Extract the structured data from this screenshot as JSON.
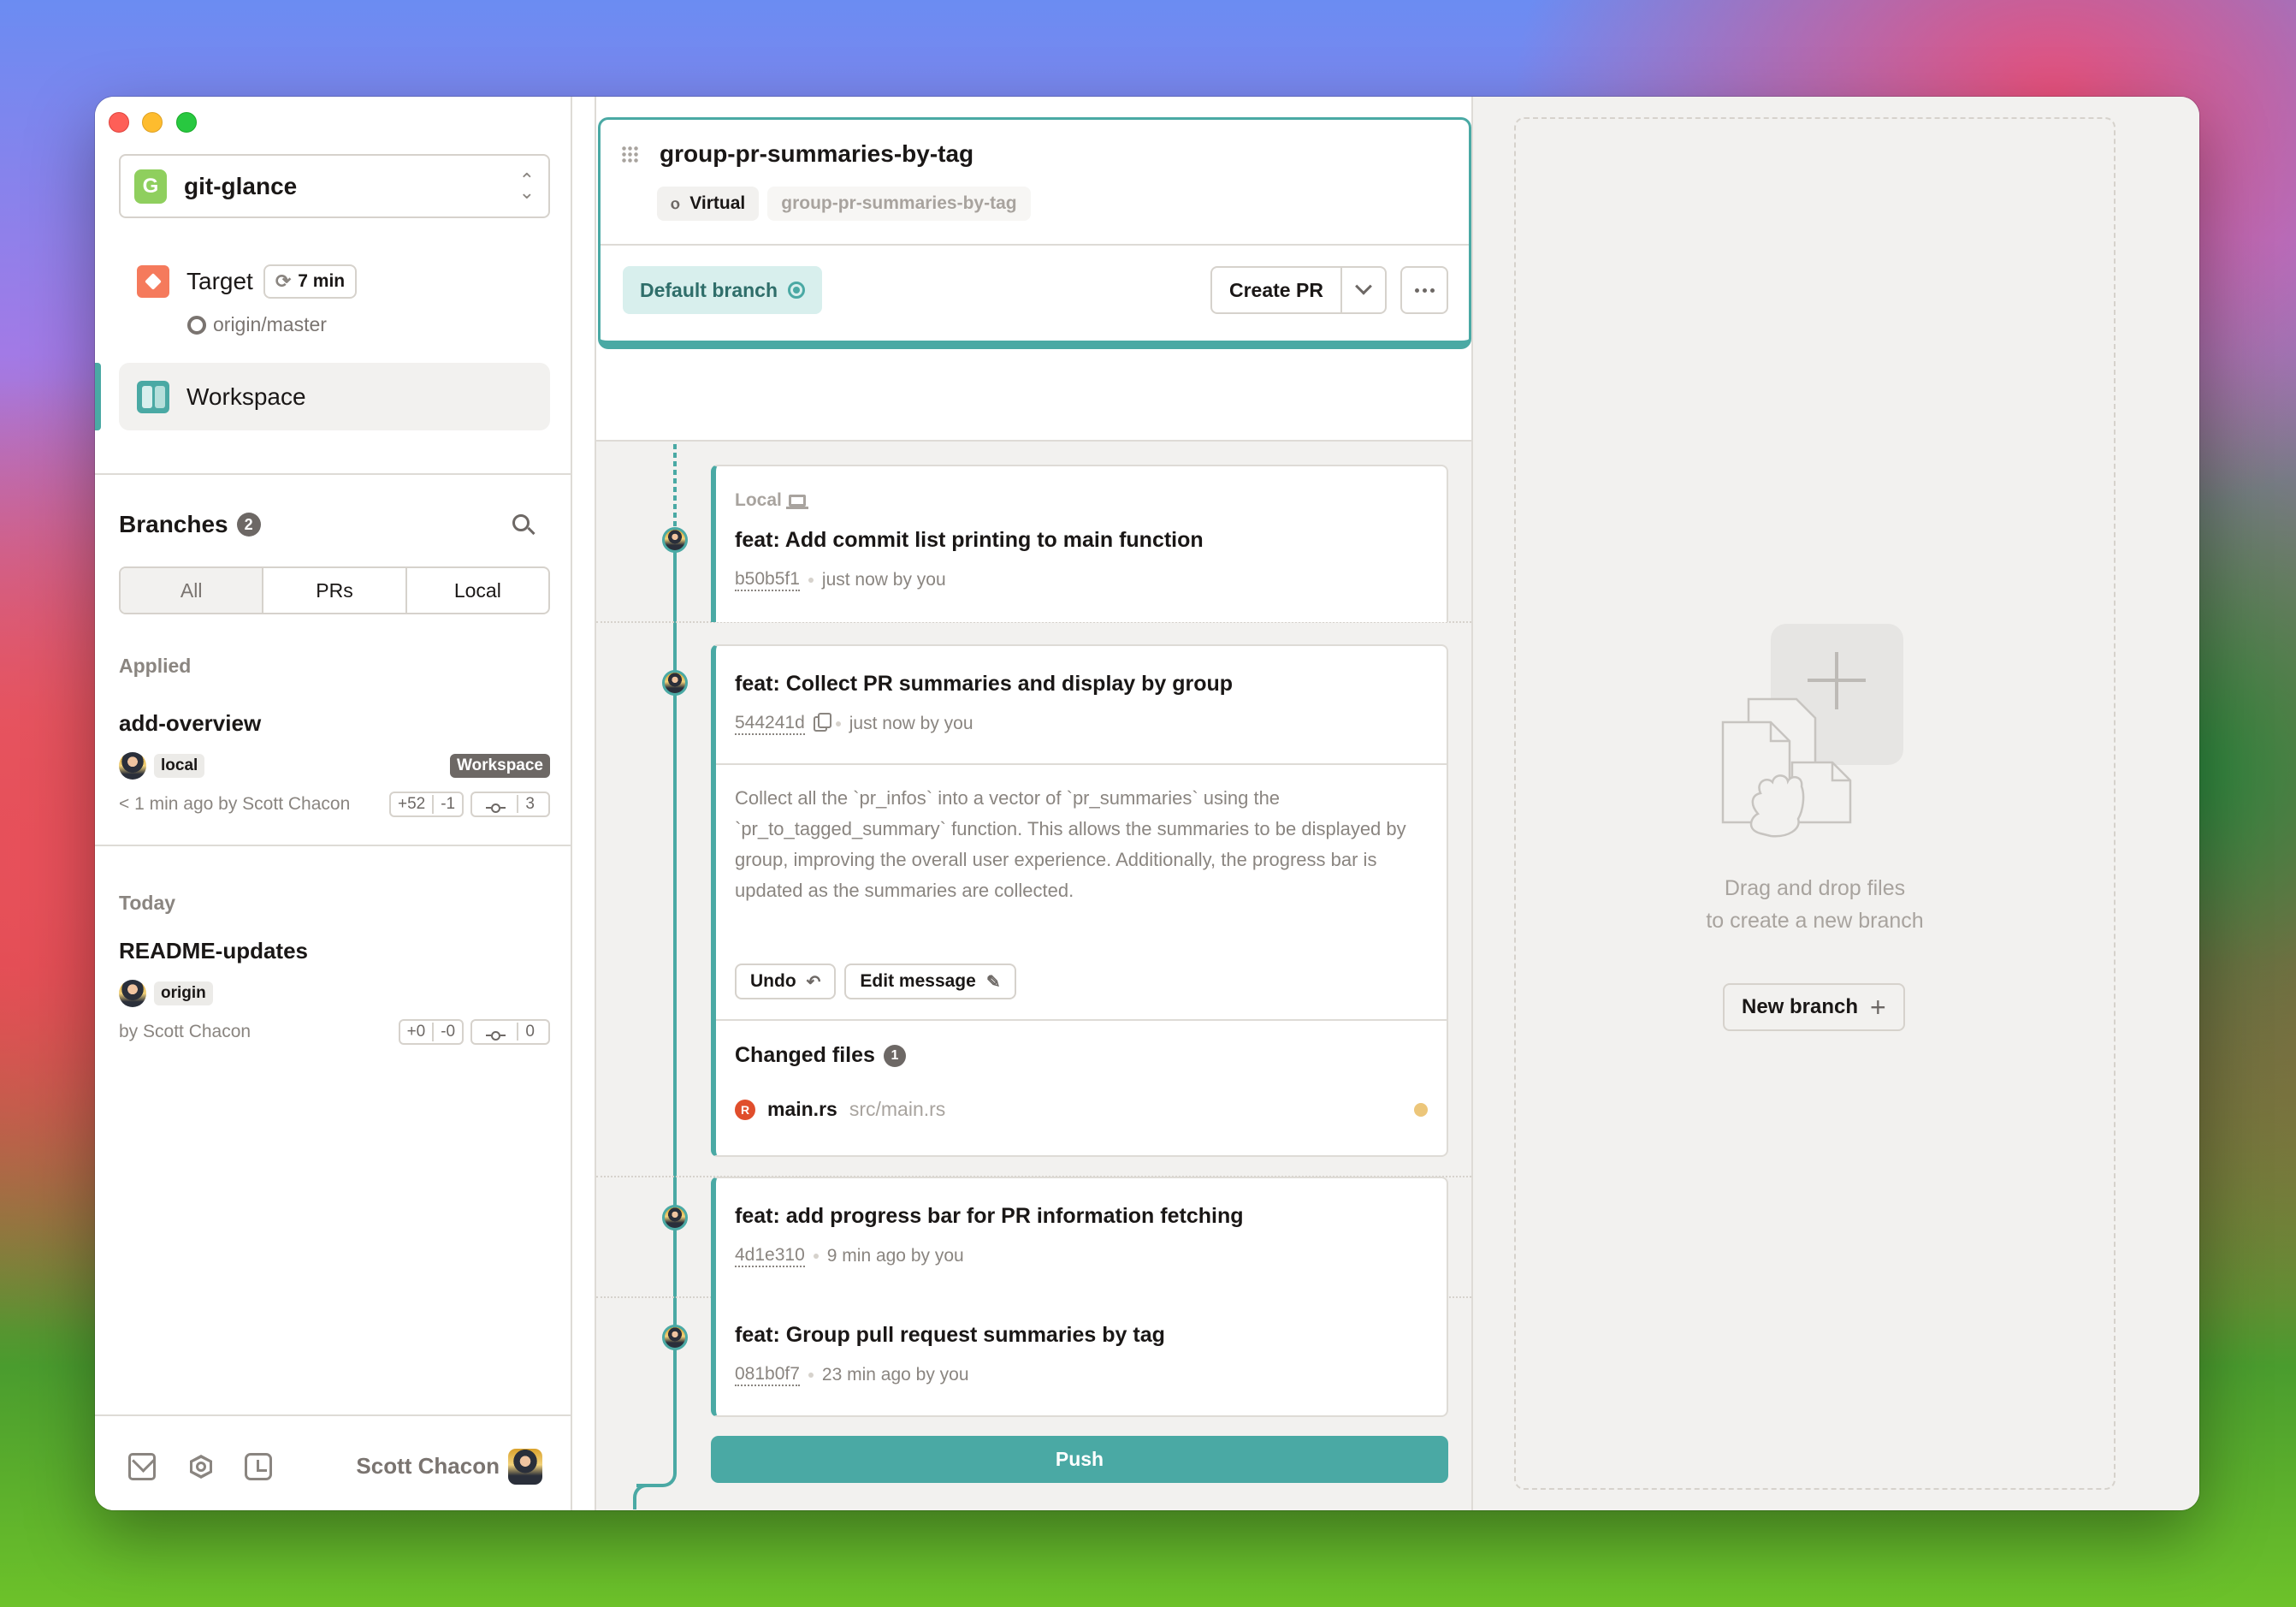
{
  "window": {
    "traffic_lights": [
      "close",
      "minimize",
      "zoom"
    ]
  },
  "sidebar": {
    "project": {
      "logo_letter": "G",
      "name": "git-glance",
      "icon": "chevron-up-down-icon"
    },
    "target": {
      "label": "Target",
      "sync_label": "7 min",
      "remote": "origin/master"
    },
    "workspace": {
      "label": "Workspace"
    },
    "branches": {
      "title": "Branches",
      "count": "2",
      "filters": [
        {
          "label": "All",
          "active": true
        },
        {
          "label": "PRs",
          "active": false
        },
        {
          "label": "Local",
          "active": false
        }
      ],
      "groups": [
        {
          "label": "Applied",
          "items": [
            {
              "name": "add-overview",
              "tag": "local",
              "badge": "Workspace",
              "meta": "< 1 min ago by Scott Chacon",
              "additions": "+52",
              "deletions": "-1",
              "commits": "3"
            }
          ]
        },
        {
          "label": "Today",
          "items": [
            {
              "name": "README-updates",
              "tag": "origin",
              "badge": "",
              "meta": "by Scott Chacon",
              "additions": "+0",
              "deletions": "-0",
              "commits": "0"
            }
          ]
        }
      ]
    },
    "footer": {
      "icons": [
        "mail-icon",
        "settings-icon",
        "history-icon"
      ],
      "user_name": "Scott Chacon"
    }
  },
  "lane": {
    "title": "group-pr-summaries-by-tag",
    "virtual_label": "Virtual",
    "branch_ref": "group-pr-summaries-by-tag",
    "default_branch_label": "Default branch",
    "create_pr_label": "Create PR",
    "commits": [
      {
        "local_label": "Local",
        "title": "feat: Add commit list printing to main function",
        "sha": "b50b5f1",
        "time": "just now by you"
      },
      {
        "title": "feat: Collect PR summaries and display by group",
        "sha": "544241d",
        "time": "just now by you",
        "body": "Collect all the `pr_infos` into a vector of `pr_summaries` using the `pr_to_tagged_summary` function. This allows the summaries to be displayed by group, improving the overall user experience. Additionally, the progress bar is updated as the summaries are collected.",
        "undo_label": "Undo",
        "edit_label": "Edit message",
        "changed_files_label": "Changed files",
        "changed_files_count": "1",
        "files": [
          {
            "name": "main.rs",
            "path": "src/main.rs",
            "status_color": "#ecc67a"
          }
        ]
      },
      {
        "title": "feat: add progress bar for PR information fetching",
        "sha": "4d1e310",
        "time": "9 min ago by you"
      },
      {
        "title": "feat: Group pull request summaries by tag",
        "sha": "081b0f7",
        "time": "23 min ago by you"
      }
    ],
    "push_label": "Push"
  },
  "drop_zone": {
    "line1": "Drag and drop files",
    "line2": "to create a new branch",
    "new_branch_label": "New branch"
  },
  "colors": {
    "accent": "#4aa9a4",
    "target": "#f57a5c",
    "project_logo": "#8fcf5e",
    "rust_file": "#e04e2c"
  }
}
